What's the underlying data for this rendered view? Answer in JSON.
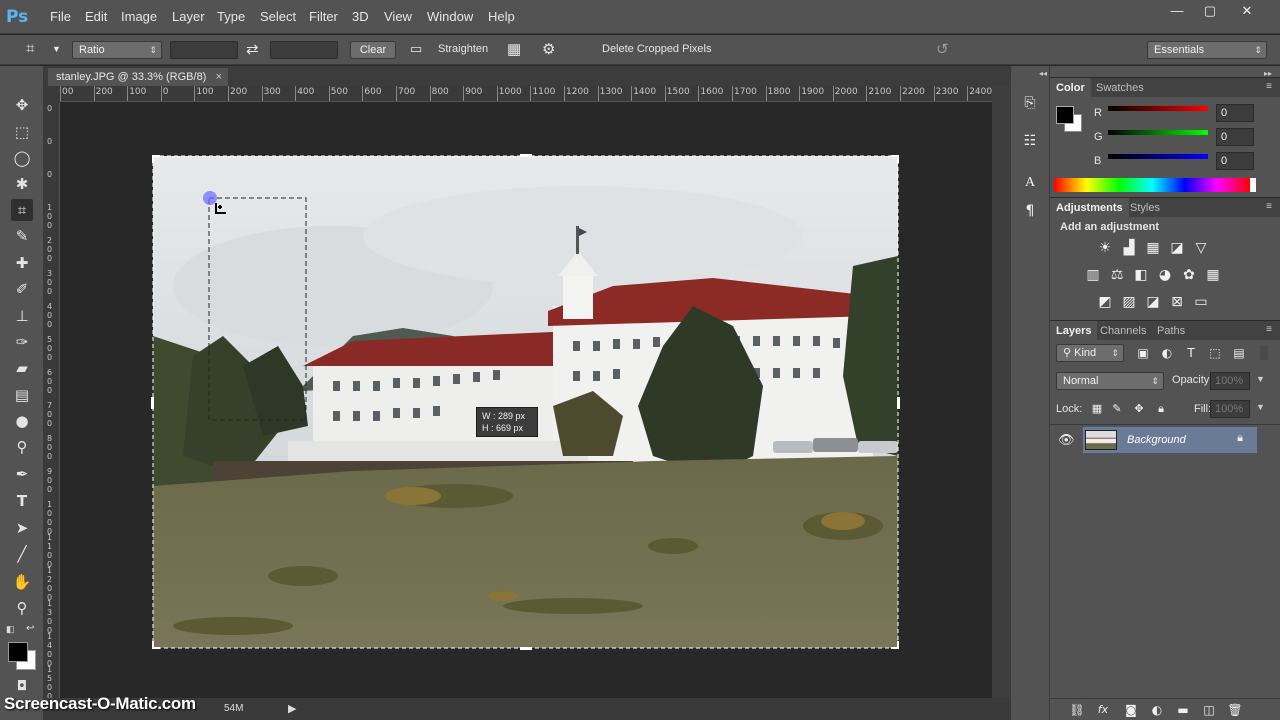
{
  "app": {
    "logo": "Ps",
    "window_controls": [
      "—",
      "▢",
      "✕"
    ]
  },
  "menu": [
    "File",
    "Edit",
    "Image",
    "Layer",
    "Type",
    "Select",
    "Filter",
    "3D",
    "View",
    "Window",
    "Help"
  ],
  "options_bar": {
    "ratio_select": "Ratio",
    "clear_label": "Clear",
    "straighten_label": "Straighten",
    "delete_cropped_label": "Delete Cropped Pixels",
    "delete_cropped_checked": true,
    "workspace_select": "Essentials"
  },
  "document": {
    "tab_label": "stanley.JPG @ 33.3% (RGB/8)",
    "tab_close": "×",
    "status_size": "54M",
    "ruler_top_labels": [
      "00",
      "200",
      "100",
      "0",
      "100",
      "200",
      "300",
      "400",
      "500",
      "600",
      "700",
      "800",
      "900",
      "1000",
      "1100",
      "1200",
      "1300",
      "1400",
      "1500",
      "1600",
      "1700",
      "1800",
      "1900",
      "2000",
      "2100",
      "2200",
      "2300",
      "2400"
    ],
    "ruler_left_labels": [
      "0",
      "0",
      "0",
      "100",
      "200",
      "300",
      "400",
      "500",
      "600",
      "700",
      "800",
      "900",
      "1000",
      "1100",
      "1200",
      "1300",
      "1400",
      "1500"
    ]
  },
  "crop_tooltip": {
    "w_label": "W :",
    "w_value": "289 px",
    "h_label": "H :",
    "h_value": "669 px"
  },
  "watermark": "Screencast-O-Matic.com",
  "color_panel": {
    "tabs": [
      "Color",
      "Swatches"
    ],
    "channels": [
      {
        "label": "R",
        "value": "0",
        "color": "#e03030"
      },
      {
        "label": "G",
        "value": "0",
        "color": "#30c030"
      },
      {
        "label": "B",
        "value": "0",
        "color": "#3040e0"
      }
    ]
  },
  "adjustments_panel": {
    "tabs": [
      "Adjustments",
      "Styles"
    ],
    "heading": "Add an adjustment"
  },
  "layers_panel": {
    "tabs": [
      "Layers",
      "Channels",
      "Paths"
    ],
    "kind_select": "Kind",
    "blend_mode": "Normal",
    "opacity_label": "Opacity:",
    "opacity_value": "100%",
    "lock_label": "Lock:",
    "fill_label": "Fill:",
    "fill_value": "100%",
    "layers": [
      {
        "name": "Background",
        "visible": true,
        "locked": true
      }
    ]
  },
  "colors": {
    "accent": "#5ab5f2",
    "selection": "#6a7b96"
  }
}
